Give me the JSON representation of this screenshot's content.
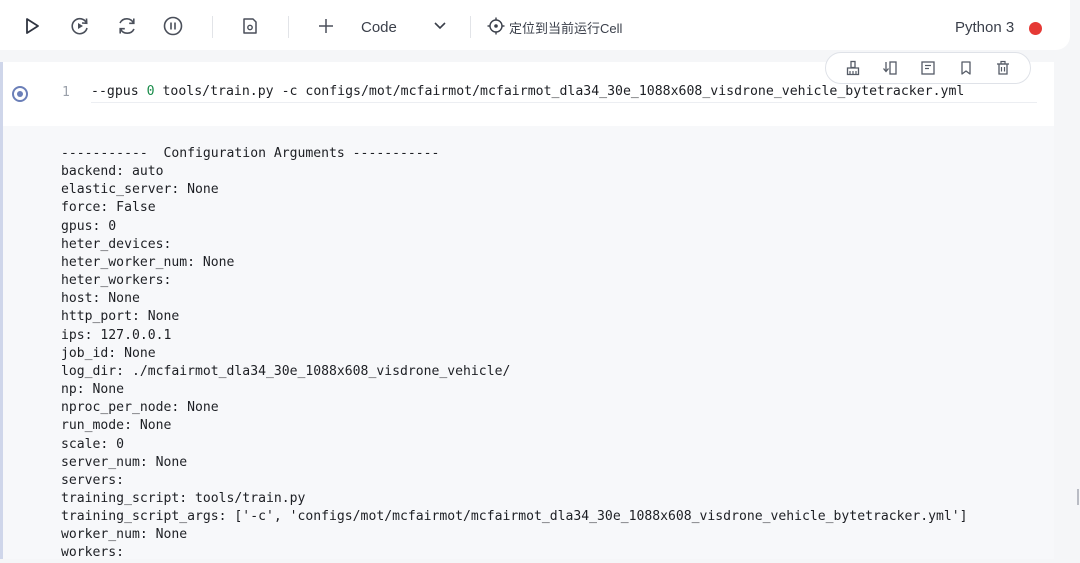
{
  "toolbar": {
    "icons": [
      "run-icon",
      "run-all-icon",
      "restart-icon",
      "interrupt-icon",
      "save-icon",
      "add-icon",
      "chevron-down-icon",
      "locate-icon"
    ],
    "cell_type": "Code",
    "locate_label": "定位到当前运行Cell",
    "kernel_name": "Python 3",
    "kernel_status_color": "#e53935"
  },
  "cell": {
    "line_number": "1",
    "code_prefix": "--gpus ",
    "code_num": "0",
    "code_suffix": " tools/train.py -c configs/mot/mcfairmot/mcfairmot_dla34_30e_1088x608_visdrone_vehicle_bytetracker.yml",
    "action_icons": [
      "clear-output-icon",
      "insert-below-icon",
      "comment-icon",
      "bookmark-icon",
      "delete-icon"
    ]
  },
  "output": {
    "lines": [
      "-----------  Configuration Arguments -----------",
      "backend: auto",
      "elastic_server: None",
      "force: False",
      "gpus: 0",
      "heter_devices:",
      "heter_worker_num: None",
      "heter_workers:",
      "host: None",
      "http_port: None",
      "ips: 127.0.0.1",
      "job_id: None",
      "log_dir: ./mcfairmot_dla34_30e_1088x608_visdrone_vehicle/",
      "np: None",
      "nproc_per_node: None",
      "run_mode: None",
      "scale: 0",
      "server_num: None",
      "servers:",
      "training_script: tools/train.py",
      "training_script_args: ['-c', 'configs/mot/mcfairmot/mcfairmot_dla34_30e_1088x608_visdrone_vehicle_bytetracker.yml']",
      "worker_num: None",
      "workers:"
    ]
  }
}
